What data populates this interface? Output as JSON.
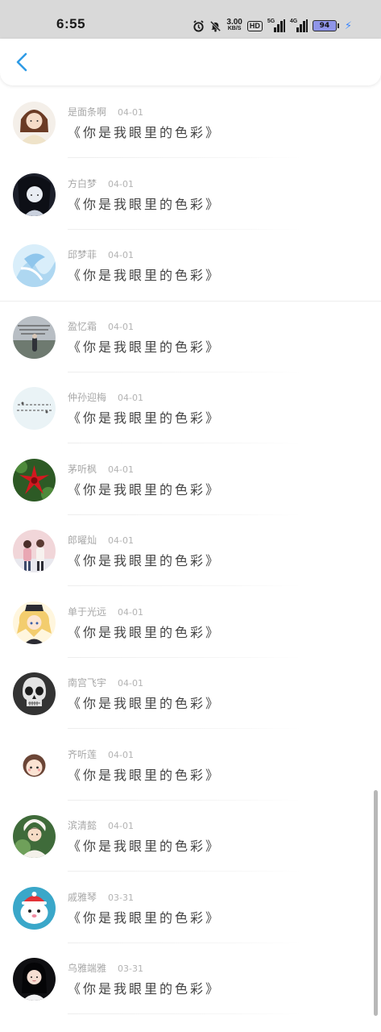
{
  "status": {
    "time": "6:55",
    "speed_value": "3.00",
    "speed_unit": "KB/S",
    "hd_label": "HD",
    "net1": "5G",
    "net2": "4G",
    "battery": "94",
    "icons": [
      "alarm-icon",
      "bell-muted-icon",
      "signal-icon",
      "charging-icon"
    ]
  },
  "header": {
    "back_icon": "chevron-left-icon",
    "accent": "#2f9be6"
  },
  "items": [
    {
      "name": "是面条啊",
      "date": "04-01",
      "message": "《你是我眼里的色彩》"
    },
    {
      "name": "方白梦",
      "date": "04-01",
      "message": "《你是我眼里的色彩》"
    },
    {
      "name": "邱梦菲",
      "date": "04-01",
      "message": "《你是我眼里的色彩》"
    },
    {
      "name": "盈忆霜",
      "date": "04-01",
      "message": "《你是我眼里的色彩》"
    },
    {
      "name": "仲孙迎梅",
      "date": "04-01",
      "message": "《你是我眼里的色彩》"
    },
    {
      "name": "茅听枫",
      "date": "04-01",
      "message": "《你是我眼里的色彩》"
    },
    {
      "name": "郎曜灿",
      "date": "04-01",
      "message": "《你是我眼里的色彩》"
    },
    {
      "name": "单于光远",
      "date": "04-01",
      "message": "《你是我眼里的色彩》"
    },
    {
      "name": "南宫飞宇",
      "date": "04-01",
      "message": "《你是我眼里的色彩》"
    },
    {
      "name": "齐听莲",
      "date": "04-01",
      "message": "《你是我眼里的色彩》"
    },
    {
      "name": "滨清懿",
      "date": "04-01",
      "message": "《你是我眼里的色彩》"
    },
    {
      "name": "戚雅琴",
      "date": "03-31",
      "message": "《你是我眼里的色彩》"
    },
    {
      "name": "乌雅端雅",
      "date": "03-31",
      "message": "《你是我眼里的色彩》"
    }
  ]
}
